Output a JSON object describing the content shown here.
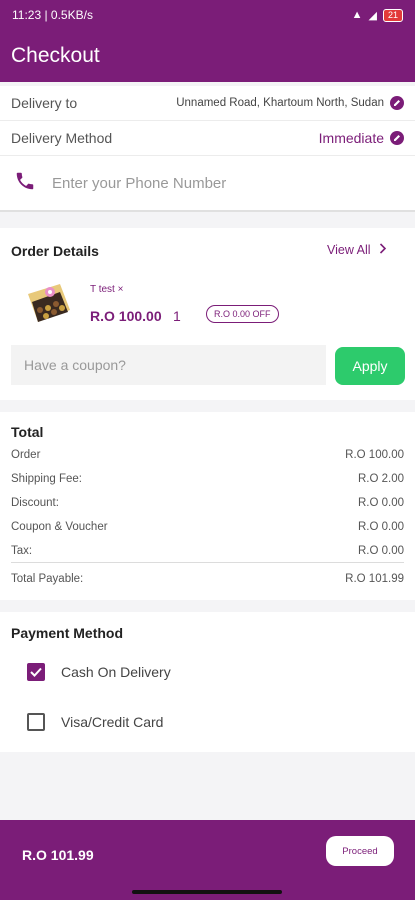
{
  "status_bar": {
    "time": "11:23 | 0.5KB/s",
    "battery": "21"
  },
  "app_bar": {
    "title": "Checkout"
  },
  "delivery": {
    "to_label": "Delivery to",
    "address": "Unnamed Road, Khartoum North, Sudan",
    "method_label": "Delivery Method",
    "method_value": "Immediate"
  },
  "phone": {
    "placeholder": "Enter your Phone Number"
  },
  "order": {
    "title": "Order Details",
    "view_all": "View All",
    "item": {
      "name": "T test ×",
      "price": "R.O 100.00",
      "qty": "1",
      "discount_badge": "R.O 0.00 OFF"
    },
    "coupon_placeholder": "Have a coupon?",
    "apply_label": "Apply"
  },
  "totals": {
    "title": "Total",
    "rows": [
      {
        "label": "Order",
        "value": "R.O 100.00"
      },
      {
        "label": "Shipping Fee:",
        "value": "R.O 2.00"
      },
      {
        "label": "Discount:",
        "value": "R.O 0.00"
      },
      {
        "label": "Coupon & Voucher",
        "value": "R.O 0.00"
      },
      {
        "label": "Tax:",
        "value": "R.O 0.00"
      }
    ],
    "payable_label": "Total Payable:",
    "payable_value": "R.O 101.99"
  },
  "payment": {
    "title": "Payment Method",
    "options": [
      {
        "label": "Cash On Delivery",
        "checked": true
      },
      {
        "label": "Visa/Credit Card",
        "checked": false
      }
    ]
  },
  "bottom": {
    "amount": "R.O 101.99",
    "proceed_label": "Proceed"
  },
  "colors": {
    "brand": "#7b1d78",
    "apply": "#2dcb6c"
  }
}
